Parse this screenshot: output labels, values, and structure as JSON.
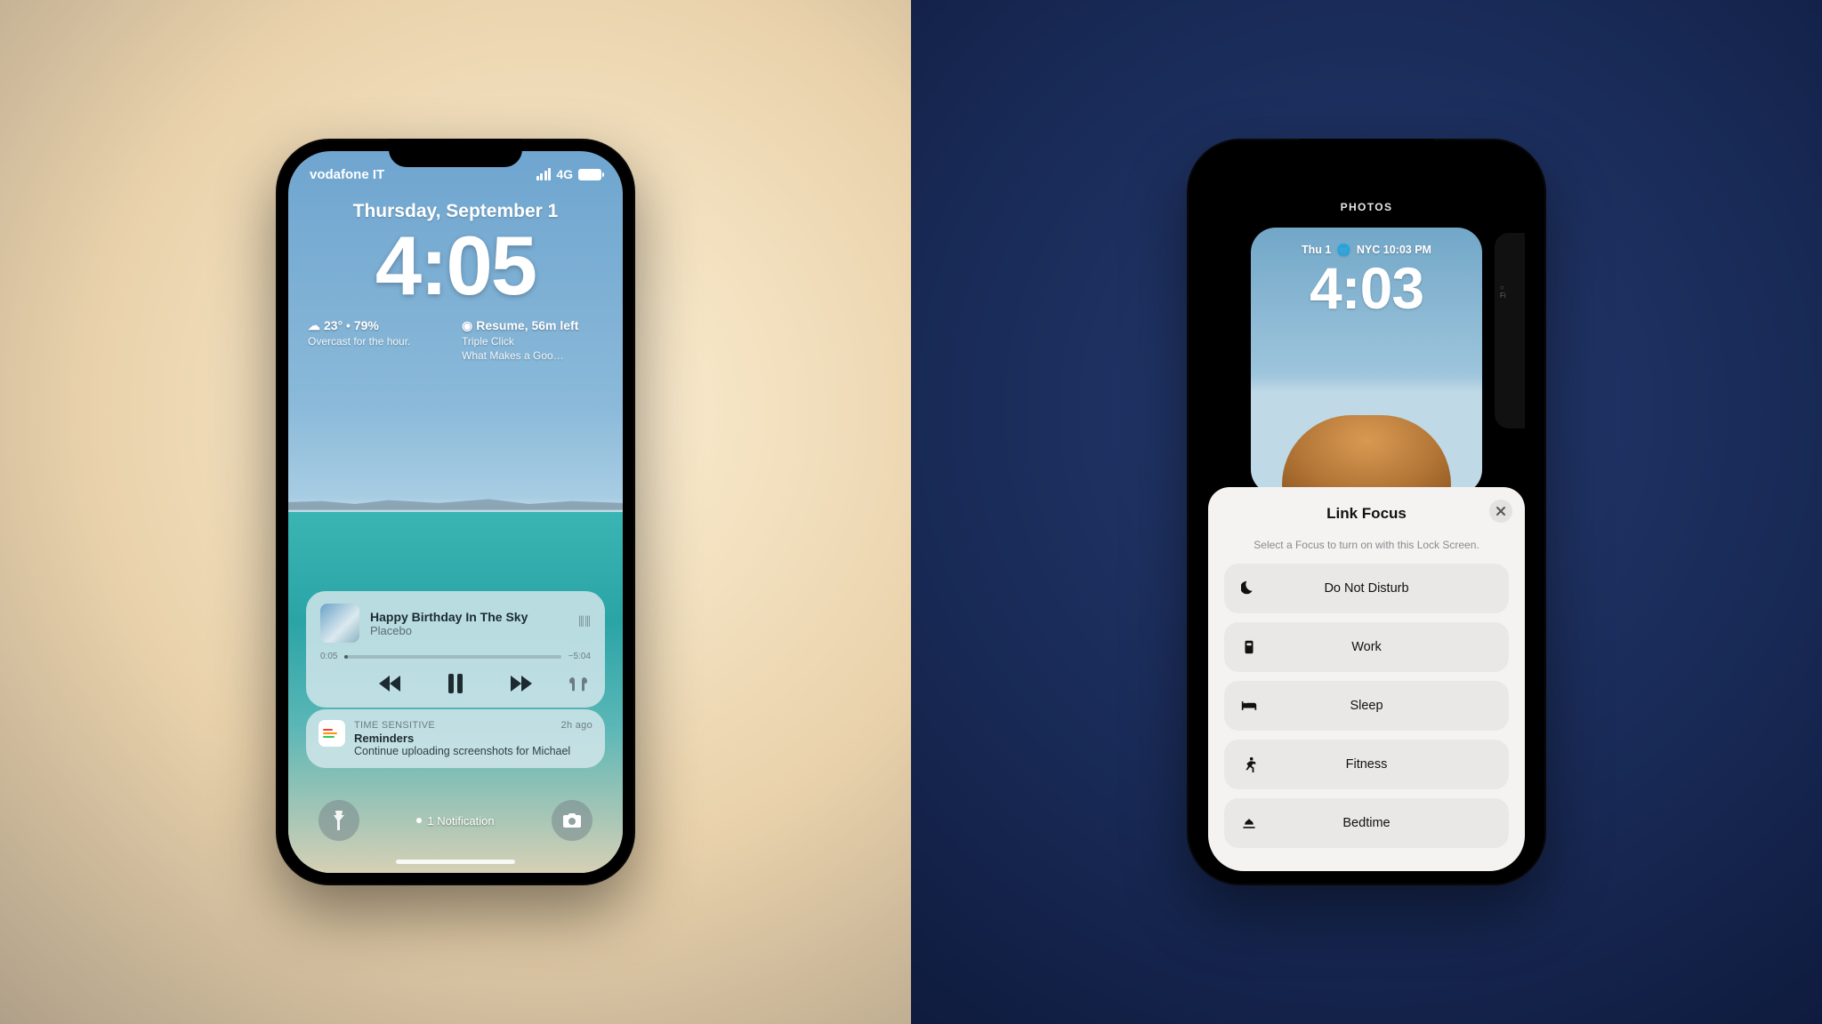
{
  "left": {
    "status": {
      "carrier": "vodafone IT",
      "net": "4G"
    },
    "date": "Thursday, September 1",
    "time": "4:05",
    "weather": {
      "line1": "23° • 79%",
      "line2": "Overcast for the hour."
    },
    "podcast": {
      "line1": "Resume, 56m left",
      "line2": "Triple Click",
      "line3": "What Makes a Goo…"
    },
    "now_playing": {
      "title": "Happy Birthday In The Sky",
      "artist": "Placebo",
      "elapsed": "0:05",
      "remaining": "−5:04",
      "progress_pct": 1.6
    },
    "reminder": {
      "tag": "TIME SENSITIVE",
      "age": "2h ago",
      "app": "Reminders",
      "body": "Continue uploading screenshots for Michael"
    },
    "notif_count": "1 Notification"
  },
  "right": {
    "header": "PHOTOS",
    "preview": {
      "day": "Thu 1",
      "city": "NYC 10:03 PM",
      "time": "4:03"
    },
    "sheet": {
      "title": "Link Focus",
      "subtitle": "Select a Focus to turn on with this Lock Screen.",
      "items": [
        {
          "label": "Do Not Disturb",
          "icon": "moon"
        },
        {
          "label": "Work",
          "icon": "badge"
        },
        {
          "label": "Sleep",
          "icon": "bed"
        },
        {
          "label": "Fitness",
          "icon": "runner"
        },
        {
          "label": "Bedtime",
          "icon": "sunset"
        }
      ]
    }
  }
}
